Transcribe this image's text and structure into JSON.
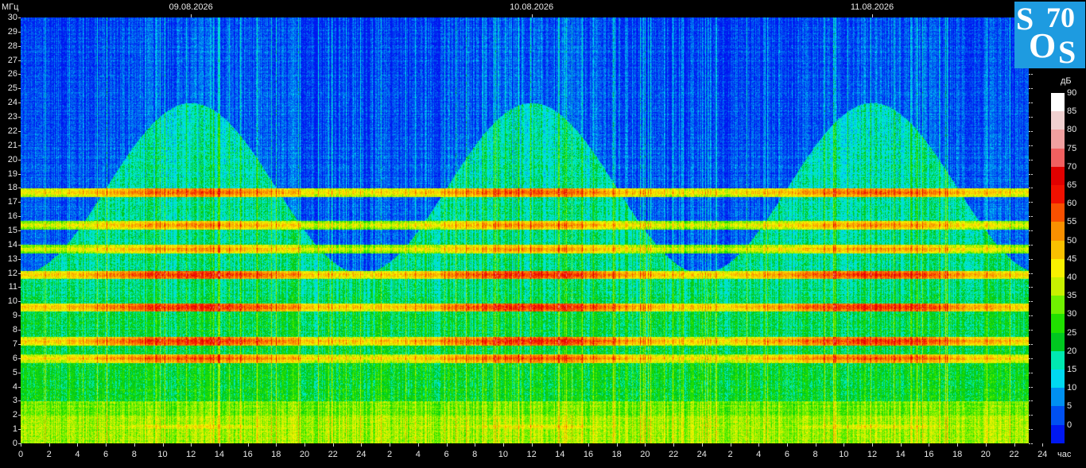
{
  "chart_data": {
    "type": "heatmap",
    "title": "",
    "ylabel": "МГц",
    "xlabel": "час",
    "colorbar_label": "дБ",
    "ylim": [
      0,
      30
    ],
    "y_ticks": [
      "0",
      "1",
      "2",
      "3",
      "4",
      "5",
      "6",
      "7",
      "8",
      "9",
      "10",
      "11",
      "12",
      "13",
      "14",
      "15",
      "16",
      "17",
      "18",
      "19",
      "20",
      "21",
      "22",
      "23",
      "24",
      "25",
      "26",
      "27",
      "28",
      "29",
      "30"
    ],
    "x_ticks": [
      "0",
      "2",
      "4",
      "6",
      "8",
      "10",
      "12",
      "14",
      "16",
      "18",
      "20",
      "22",
      "24",
      "2",
      "4",
      "6",
      "8",
      "10",
      "12",
      "14",
      "16",
      "18",
      "20",
      "22",
      "24",
      "2",
      "4",
      "6",
      "8",
      "10",
      "12",
      "14",
      "16",
      "18",
      "20",
      "22",
      "24"
    ],
    "date_labels": [
      {
        "text": "09.08.2026",
        "hour": 12
      },
      {
        "text": "10.08.2026",
        "hour": 36
      },
      {
        "text": "11.08.2026",
        "hour": 60
      }
    ],
    "x_range_hours": [
      0,
      71
    ],
    "colorbar": {
      "ticks": [
        "0",
        "5",
        "10",
        "15",
        "20",
        "25",
        "30",
        "35",
        "40",
        "45",
        "50",
        "55",
        "60",
        "65",
        "70",
        "75",
        "80",
        "85",
        "90"
      ],
      "colors": [
        "#0018f0",
        "#0050f0",
        "#0090f0",
        "#00d8f0",
        "#00e8b0",
        "#00c820",
        "#20e000",
        "#70f000",
        "#c8f000",
        "#f8f000",
        "#f8c000",
        "#f89000",
        "#f85000",
        "#f01000",
        "#e00000",
        "#f06060",
        "#f0a0a0",
        "#f0d0d0",
        "#ffffff"
      ]
    },
    "bands_mhz": [
      {
        "freq": 1.2,
        "level": 45
      },
      {
        "freq": 6.0,
        "level": 60
      },
      {
        "freq": 7.2,
        "level": 65
      },
      {
        "freq": 9.6,
        "level": 65
      },
      {
        "freq": 11.9,
        "level": 65
      },
      {
        "freq": 13.7,
        "level": 55
      },
      {
        "freq": 15.4,
        "level": 55
      },
      {
        "freq": 17.7,
        "level": 60
      }
    ]
  },
  "logo": {
    "s1": "S",
    "seventy": "70",
    "o": "O",
    "s2": "S"
  }
}
